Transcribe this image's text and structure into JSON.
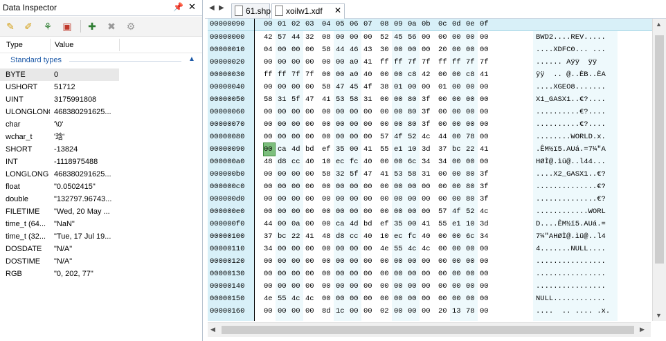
{
  "inspector": {
    "title": "Data Inspector",
    "columns": {
      "type": "Type",
      "value": "Value"
    },
    "group": "Standard types",
    "rows": [
      {
        "type": "BYTE",
        "value": "0"
      },
      {
        "type": "USHORT",
        "value": "51712"
      },
      {
        "type": "UINT",
        "value": "3175991808"
      },
      {
        "type": "ULONGLONG",
        "value": "468380291625..."
      },
      {
        "type": "char",
        "value": "'\\0'"
      },
      {
        "type": "wchar_t",
        "value": "'琀'"
      },
      {
        "type": "SHORT",
        "value": "-13824"
      },
      {
        "type": "INT",
        "value": "-1118975488"
      },
      {
        "type": "LONGLONG",
        "value": "468380291625..."
      },
      {
        "type": "float",
        "value": "\"0.0502415\""
      },
      {
        "type": "double",
        "value": "\"132797.96743..."
      },
      {
        "type": "FILETIME",
        "value": "\"Wed, 20 May ..."
      },
      {
        "type": "time_t (64...",
        "value": "\"NaN\""
      },
      {
        "type": "time_t (32...",
        "value": "\"Tue, 17 Jul 19..."
      },
      {
        "type": "DOSDATE",
        "value": "\"N/A\""
      },
      {
        "type": "DOSTIME",
        "value": "\"N/A\""
      },
      {
        "type": "RGB",
        "value": "\"0, 202, 77\""
      }
    ]
  },
  "tabs": [
    {
      "label": "61.shp"
    },
    {
      "label": "xoilw1.xdf"
    }
  ],
  "hex": {
    "current_offset": "00000090",
    "column_header": [
      "00",
      "01",
      "02",
      "03",
      "04",
      "05",
      "06",
      "07",
      "08",
      "09",
      "0a",
      "0b",
      "0c",
      "0d",
      "0e",
      "0f"
    ],
    "rows": [
      {
        "offset": "00000000",
        "bytes": [
          "42",
          "57",
          "44",
          "32",
          "08",
          "00",
          "00",
          "00",
          "52",
          "45",
          "56",
          "00",
          "00",
          "00",
          "00",
          "00"
        ],
        "ascii": "BWD2....REV....."
      },
      {
        "offset": "00000010",
        "bytes": [
          "04",
          "00",
          "00",
          "00",
          "58",
          "44",
          "46",
          "43",
          "30",
          "00",
          "00",
          "00",
          "20",
          "00",
          "00",
          "00"
        ],
        "ascii": "....XDFC0... ..."
      },
      {
        "offset": "00000020",
        "bytes": [
          "00",
          "00",
          "00",
          "00",
          "00",
          "00",
          "a0",
          "41",
          "ff",
          "ff",
          "7f",
          "7f",
          "ff",
          "ff",
          "7f",
          "7f"
        ],
        "ascii": "...... Aÿÿ  ÿÿ  "
      },
      {
        "offset": "00000030",
        "bytes": [
          "ff",
          "ff",
          "7f",
          "7f",
          "00",
          "00",
          "a0",
          "40",
          "00",
          "00",
          "c8",
          "42",
          "00",
          "00",
          "c8",
          "41"
        ],
        "ascii": "ÿÿ  .. @..ÈB..ÈA"
      },
      {
        "offset": "00000040",
        "bytes": [
          "00",
          "00",
          "00",
          "00",
          "58",
          "47",
          "45",
          "4f",
          "38",
          "01",
          "00",
          "00",
          "01",
          "00",
          "00",
          "00"
        ],
        "ascii": "....XGEO8......."
      },
      {
        "offset": "00000050",
        "bytes": [
          "58",
          "31",
          "5f",
          "47",
          "41",
          "53",
          "58",
          "31",
          "00",
          "00",
          "80",
          "3f",
          "00",
          "00",
          "00",
          "00"
        ],
        "ascii": "X1_GASX1..€?...."
      },
      {
        "offset": "00000060",
        "bytes": [
          "00",
          "00",
          "00",
          "00",
          "00",
          "00",
          "00",
          "00",
          "00",
          "00",
          "80",
          "3f",
          "00",
          "00",
          "00",
          "00"
        ],
        "ascii": "..........€?...."
      },
      {
        "offset": "00000070",
        "bytes": [
          "00",
          "00",
          "00",
          "00",
          "00",
          "00",
          "00",
          "00",
          "00",
          "00",
          "80",
          "3f",
          "00",
          "00",
          "00",
          "00"
        ],
        "ascii": "..........€?...."
      },
      {
        "offset": "00000080",
        "bytes": [
          "00",
          "00",
          "00",
          "00",
          "00",
          "00",
          "00",
          "00",
          "57",
          "4f",
          "52",
          "4c",
          "44",
          "00",
          "78",
          "00"
        ],
        "ascii": "........WORLD.x."
      },
      {
        "offset": "00000090",
        "bytes": [
          "00",
          "ca",
          "4d",
          "bd",
          "ef",
          "35",
          "00",
          "41",
          "55",
          "e1",
          "10",
          "3d",
          "37",
          "bc",
          "22",
          "41"
        ],
        "ascii": ".ÊM½ï5.AUá.=7¼\"A"
      },
      {
        "offset": "000000a0",
        "bytes": [
          "48",
          "d8",
          "cc",
          "40",
          "10",
          "ec",
          "fc",
          "40",
          "00",
          "00",
          "6c",
          "34",
          "34",
          "00",
          "00",
          "00"
        ],
        "ascii": "HØÌ@.ìü@..l44..."
      },
      {
        "offset": "000000b0",
        "bytes": [
          "00",
          "00",
          "00",
          "00",
          "58",
          "32",
          "5f",
          "47",
          "41",
          "53",
          "58",
          "31",
          "00",
          "00",
          "80",
          "3f"
        ],
        "ascii": "....X2_GASX1..€?"
      },
      {
        "offset": "000000c0",
        "bytes": [
          "00",
          "00",
          "00",
          "00",
          "00",
          "00",
          "00",
          "00",
          "00",
          "00",
          "00",
          "00",
          "00",
          "00",
          "80",
          "3f"
        ],
        "ascii": "..............€?"
      },
      {
        "offset": "000000d0",
        "bytes": [
          "00",
          "00",
          "00",
          "00",
          "00",
          "00",
          "00",
          "00",
          "00",
          "00",
          "00",
          "00",
          "00",
          "00",
          "80",
          "3f"
        ],
        "ascii": "..............€?"
      },
      {
        "offset": "000000e0",
        "bytes": [
          "00",
          "00",
          "00",
          "00",
          "00",
          "00",
          "00",
          "00",
          "00",
          "00",
          "00",
          "00",
          "57",
          "4f",
          "52",
          "4c"
        ],
        "ascii": "............WORL"
      },
      {
        "offset": "000000f0",
        "bytes": [
          "44",
          "00",
          "0a",
          "00",
          "00",
          "ca",
          "4d",
          "bd",
          "ef",
          "35",
          "00",
          "41",
          "55",
          "e1",
          "10",
          "3d"
        ],
        "ascii": "D....ÊM½ï5.AUá.="
      },
      {
        "offset": "00000100",
        "bytes": [
          "37",
          "bc",
          "22",
          "41",
          "48",
          "d8",
          "cc",
          "40",
          "10",
          "ec",
          "fc",
          "40",
          "00",
          "00",
          "6c",
          "34"
        ],
        "ascii": "7¼\"AHØÌ@.ìü@..l4"
      },
      {
        "offset": "00000110",
        "bytes": [
          "34",
          "00",
          "00",
          "00",
          "00",
          "00",
          "00",
          "00",
          "4e",
          "55",
          "4c",
          "4c",
          "00",
          "00",
          "00",
          "00"
        ],
        "ascii": "4.......NULL...."
      },
      {
        "offset": "00000120",
        "bytes": [
          "00",
          "00",
          "00",
          "00",
          "00",
          "00",
          "00",
          "00",
          "00",
          "00",
          "00",
          "00",
          "00",
          "00",
          "00",
          "00"
        ],
        "ascii": "................"
      },
      {
        "offset": "00000130",
        "bytes": [
          "00",
          "00",
          "00",
          "00",
          "00",
          "00",
          "00",
          "00",
          "00",
          "00",
          "00",
          "00",
          "00",
          "00",
          "00",
          "00"
        ],
        "ascii": "................"
      },
      {
        "offset": "00000140",
        "bytes": [
          "00",
          "00",
          "00",
          "00",
          "00",
          "00",
          "00",
          "00",
          "00",
          "00",
          "00",
          "00",
          "00",
          "00",
          "00",
          "00"
        ],
        "ascii": "................"
      },
      {
        "offset": "00000150",
        "bytes": [
          "4e",
          "55",
          "4c",
          "4c",
          "00",
          "00",
          "00",
          "00",
          "00",
          "00",
          "00",
          "00",
          "00",
          "00",
          "00",
          "00"
        ],
        "ascii": "NULL............"
      },
      {
        "offset": "00000160",
        "bytes": [
          "00",
          "00",
          "00",
          "00",
          "8d",
          "1c",
          "00",
          "00",
          "02",
          "00",
          "00",
          "00",
          "20",
          "13",
          "78",
          "00"
        ],
        "ascii": "....  .. .... .x."
      }
    ]
  },
  "colors": {
    "offset_bg": "#d8f0f8",
    "cursor": "#7dbf7d",
    "accent": "#1e5aa8"
  }
}
